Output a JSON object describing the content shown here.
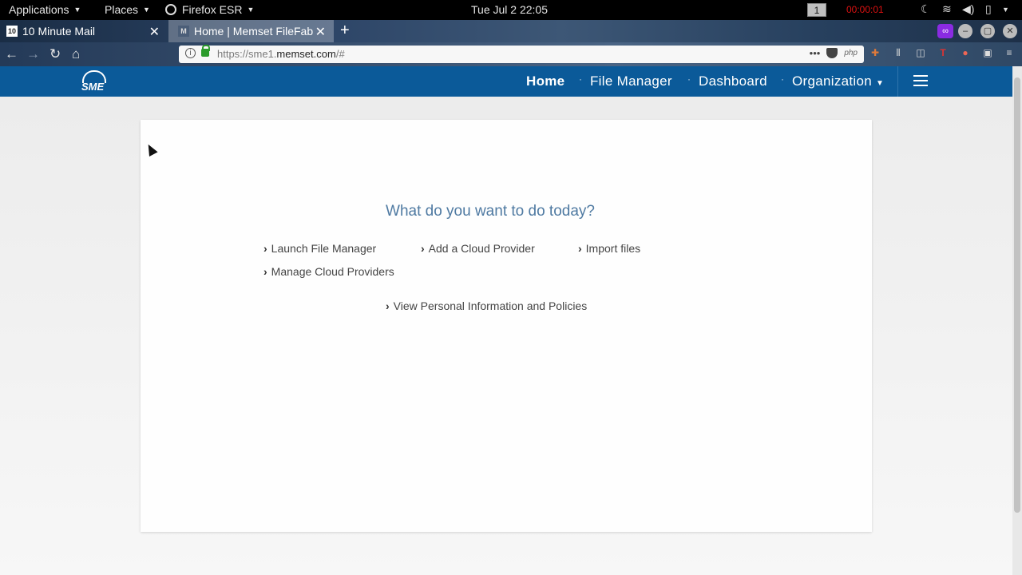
{
  "system_bar": {
    "applications": "Applications",
    "places": "Places",
    "browser_menu": "Firefox ESR",
    "clock": "Tue Jul 2  22:05",
    "workspace": "1",
    "timer": "00:00:01"
  },
  "browser": {
    "tabs": [
      {
        "favicon": "10",
        "title": "10 Minute Mail"
      },
      {
        "favicon": "M",
        "title": "Home | Memset FileFab"
      }
    ],
    "url": {
      "prefix": "https://sme1.",
      "host": "memset.com",
      "suffix": "/#"
    },
    "url_extra": "php"
  },
  "site": {
    "logo_text": "SME",
    "nav": {
      "home": "Home",
      "file_manager": "File Manager",
      "dashboard": "Dashboard",
      "organization": "Organization"
    }
  },
  "main": {
    "question": "What do you want to do today?",
    "actions": {
      "launch_file_manager": "Launch File Manager",
      "add_cloud_provider": "Add a Cloud Provider",
      "import_files": "Import files",
      "manage_cloud_providers": "Manage Cloud Providers",
      "view_personal_info": "View Personal Information and Policies"
    }
  }
}
